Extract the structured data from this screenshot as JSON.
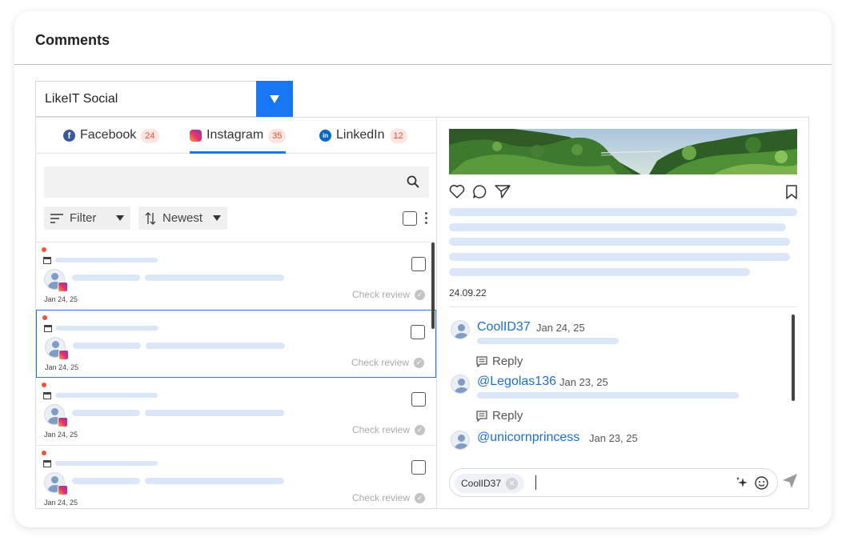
{
  "page": {
    "title": "Comments"
  },
  "account_select": {
    "value": "LikeIT Social"
  },
  "tabs": [
    {
      "label": "Facebook",
      "count": "24",
      "icon": "facebook-icon"
    },
    {
      "label": "Instagram",
      "count": "35",
      "icon": "instagram-icon",
      "active": true
    },
    {
      "label": "LinkedIn",
      "count": "12",
      "icon": "linkedin-icon"
    }
  ],
  "toolbar": {
    "filter_label": "Filter",
    "sort_label": "Newest"
  },
  "list_items": [
    {
      "date": "Jan 24, 25",
      "status": "Check review"
    },
    {
      "date": "Jan 24, 25",
      "status": "Check review",
      "selected": true
    },
    {
      "date": "Jan 24, 25",
      "status": "Check review"
    },
    {
      "date": "Jan 24, 25",
      "status": "Check review"
    }
  ],
  "post": {
    "date": "24.09.22"
  },
  "comments": [
    {
      "author": "CoolID37",
      "date": "Jan 24, 25",
      "reply_label": "Reply"
    },
    {
      "author": "@Legolas136",
      "date": "Jan 23, 25",
      "reply_label": "Reply"
    },
    {
      "author": "@unicornprincess",
      "date": "Jan 23, 25"
    }
  ],
  "composer": {
    "mention_chip": "CoolID37"
  },
  "colors": {
    "accent": "#1976f2",
    "badge_text": "#e0523c",
    "skeleton": "#dbe6f8",
    "link": "#1a6ed8"
  }
}
